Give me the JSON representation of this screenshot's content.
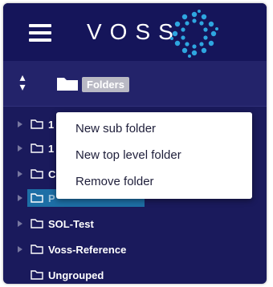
{
  "header": {
    "brand": "VOSS",
    "menu_icon": "hamburger-menu-icon",
    "logo_icon": "voss-dots-logo-icon"
  },
  "toolbar": {
    "sort_icon": "expand-collapse-icon",
    "folders_label": "Folders",
    "folder_icon": "folder-icon"
  },
  "tree": {
    "items": [
      {
        "label": "1",
        "expandable": true
      },
      {
        "label": "1",
        "expandable": true
      },
      {
        "label": "C",
        "expandable": true
      },
      {
        "label": "P",
        "expandable": true,
        "selected": true
      },
      {
        "label": "SOL-Test",
        "expandable": true
      },
      {
        "label": "Voss-Reference",
        "expandable": true
      },
      {
        "label": "Ungrouped",
        "expandable": false
      }
    ]
  },
  "context_menu": {
    "items": [
      {
        "label": "New sub folder"
      },
      {
        "label": "New top level folder"
      },
      {
        "label": "Remove folder"
      }
    ]
  },
  "colors": {
    "panel": "#1a1a5c",
    "header": "#15155a",
    "selected_row": "#1d6fa6",
    "logo": "#2ea6e0",
    "menu_text": "#1e1e3a"
  }
}
